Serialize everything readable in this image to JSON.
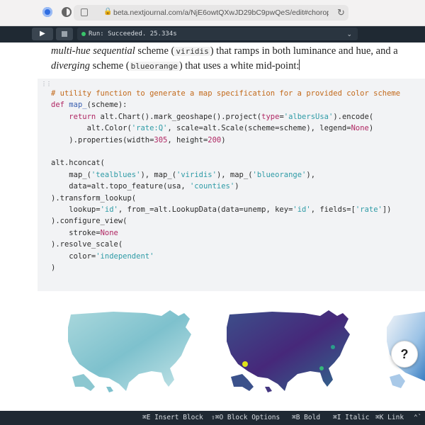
{
  "browser": {
    "url": "beta.nextjournal.com/a/NjE6owtQXwJD29bC9pwQeS/edit#choropleth-map"
  },
  "toolbar": {
    "run_icon": "play-icon",
    "status": "Run: Succeeded.  25.334s",
    "status_color": "#39c46a"
  },
  "prose": {
    "part1": "multi-hue sequential",
    "part2": " scheme (",
    "code1": "viridis",
    "part3": ") that ramps in both luminance and hue, and a ",
    "part4": "diverging",
    "part5": " scheme (",
    "code2": "blueorange",
    "part6": ") that uses a white mid-point:"
  },
  "code": {
    "comment": "# utility function to generate a map specification for a provided color scheme",
    "l2_kw": "def",
    "l2_fn": "map_",
    "l2_rest": "(scheme):",
    "l3_kw": "return",
    "l3_a": " alt.Chart().mark_geoshape().project(",
    "l3_b": "type",
    "l3_c": "=",
    "l3_str": "'albersUsa'",
    "l3_d": ").encode(",
    "l4_a": "alt.Color(",
    "l4_str": "'rate:Q'",
    "l4_b": ", scale=alt.Scale(scheme=scheme), legend=",
    "l4_none": "None",
    "l4_c": ")",
    "l5_a": ").properties(width=",
    "l5_n1": "305",
    "l5_b": ", height=",
    "l5_n2": "200",
    "l5_c": ")",
    "l7": "alt.hconcat(",
    "l8_a": "map_(",
    "l8_s1": "'tealblues'",
    "l8_b": "), map_(",
    "l8_s2": "'viridis'",
    "l8_c": "), map_(",
    "l8_s3": "'blueorange'",
    "l8_d": "),",
    "l9_a": "data=alt.topo_feature(usa, ",
    "l9_s": "'counties'",
    "l9_b": ")",
    "l10": ").transform_lookup(",
    "l11_a": "lookup=",
    "l11_s1": "'id'",
    "l11_b": ", from_=alt.LookupData(data=unemp, key=",
    "l11_s2": "'id'",
    "l11_c": ", fields=[",
    "l11_s3": "'rate'",
    "l11_d": "])",
    "l12": ").configure_view(",
    "l13_a": "stroke=",
    "l13_none": "None",
    "l14": ").resolve_scale(",
    "l15_a": "color=",
    "l15_s": "'independent'",
    "l16": ")"
  },
  "help": {
    "label": "?"
  },
  "bottombar": {
    "insert": "⌘E Insert Block",
    "options": "⇧⌘O Block Options",
    "bold": "⌘B Bold",
    "italic": "⌘I Italic",
    "link": "⌘K Link",
    "more": "⌃`"
  }
}
